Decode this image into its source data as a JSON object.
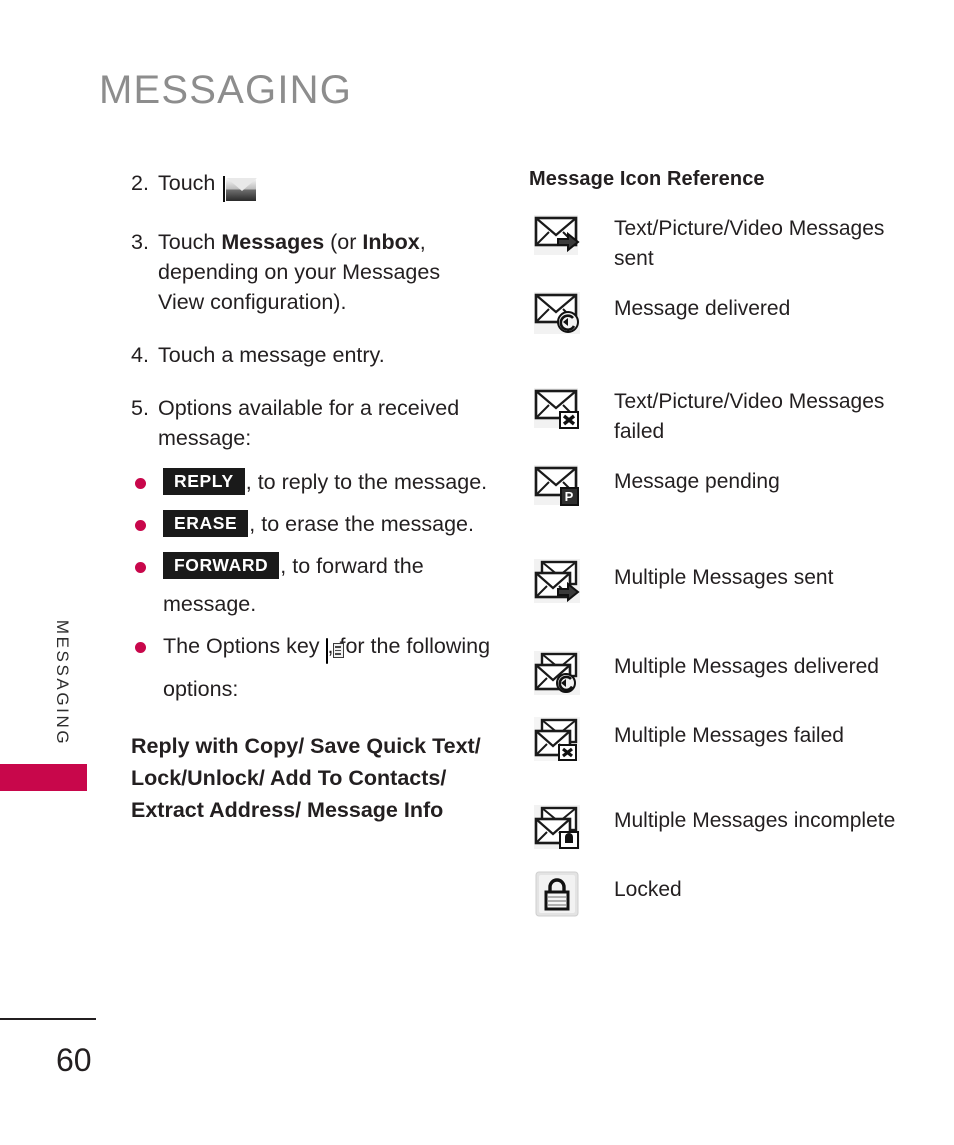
{
  "header": {
    "title": "MESSAGING"
  },
  "sidebar": {
    "vertical_label": "MESSAGING",
    "tab_color": "#c8074b"
  },
  "footer": {
    "page_number": "60"
  },
  "left_column": {
    "steps": [
      {
        "number": "2.",
        "text_before": "Touch",
        "icon": "envelope-key-icon",
        "text_after": "."
      },
      {
        "number": "3.",
        "parts": [
          "Touch ",
          "Messages",
          " (or ",
          "Inbox",
          ", depending on your Messages View configuration)."
        ]
      },
      {
        "number": "4.",
        "text": "Touch a message entry."
      },
      {
        "number": "5.",
        "text": "Options available for a received message:"
      }
    ],
    "bullets": [
      {
        "chip": "REPLY",
        "text": ", to reply to the message."
      },
      {
        "chip": "ERASE",
        "text": ", to erase the message."
      },
      {
        "chip": "FORWARD",
        "text": ", to forward the message."
      },
      {
        "prefix": "The Options key",
        "icon": "options-key-icon",
        "text": ", for the following options:"
      }
    ],
    "options_list": "Reply with Copy/ Save Quick Text/ Lock/Unlock/ Add To Contacts/ Extract Address/ Message Info"
  },
  "right_column": {
    "heading": "Message Icon Reference",
    "items": [
      {
        "icon": "envelope-sent-icon",
        "label": "Text/Picture/Video Messages sent"
      },
      {
        "icon": "envelope-delivered-icon",
        "label": "Message delivered"
      },
      {
        "icon": "envelope-failed-icon",
        "label": "Text/Picture/Video Messages failed"
      },
      {
        "icon": "envelope-pending-icon",
        "label": "Message pending"
      },
      {
        "icon": "multi-envelope-sent-icon",
        "label": "Multiple Messages sent"
      },
      {
        "icon": "multi-envelope-delivered-icon",
        "label": "Multiple Messages delivered"
      },
      {
        "icon": "multi-envelope-failed-icon",
        "label": "Multiple Messages failed"
      },
      {
        "icon": "multi-envelope-incomplete-icon",
        "label": "Multiple Messages incomplete"
      },
      {
        "icon": "lock-icon",
        "label": "Locked"
      }
    ]
  }
}
